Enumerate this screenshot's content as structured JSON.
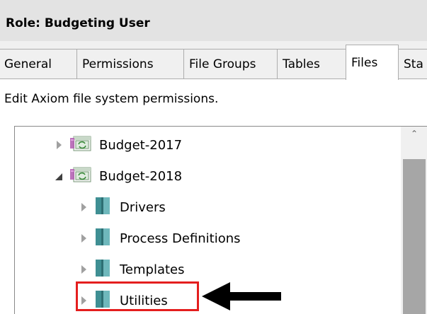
{
  "window": {
    "title": "Role: Budgeting User"
  },
  "tabs": [
    {
      "label": "General",
      "active": false
    },
    {
      "label": "Permissions",
      "active": false
    },
    {
      "label": "File Groups",
      "active": false
    },
    {
      "label": "Tables",
      "active": false
    },
    {
      "label": "Files",
      "active": true
    },
    {
      "label": "Sta",
      "active": false
    }
  ],
  "description": "Edit Axiom file system permissions.",
  "tree": {
    "nodes": [
      {
        "label": "Budget-2017",
        "type": "file-group",
        "state": "collapsed",
        "level": 0
      },
      {
        "label": "Budget-2018",
        "type": "file-group",
        "state": "expanded",
        "level": 0
      },
      {
        "label": "Drivers",
        "type": "folder",
        "state": "collapsed",
        "level": 1
      },
      {
        "label": "Process Definitions",
        "type": "folder",
        "state": "collapsed",
        "level": 1
      },
      {
        "label": "Templates",
        "type": "folder",
        "state": "collapsed",
        "level": 1
      },
      {
        "label": "Utilities",
        "type": "folder",
        "state": "collapsed",
        "level": 1,
        "highlighted": true
      }
    ]
  },
  "annotations": {
    "highlight_color": "#e41e1e",
    "arrow_color": "#000000",
    "arrow_target": "Utilities"
  },
  "icons": {
    "file_group": "file-group-icon",
    "folder": "folder-icon",
    "expand": "expand-triangle-icon",
    "collapse": "collapse-triangle-icon",
    "scroll_up": "scroll-up-icon"
  }
}
